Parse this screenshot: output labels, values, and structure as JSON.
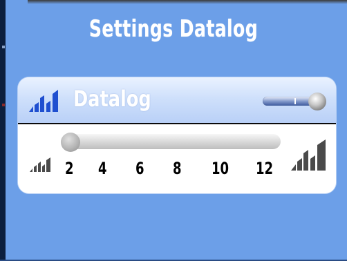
{
  "window": {
    "title": "Settings Datalog"
  },
  "card": {
    "label": "Datalog",
    "toggle_state": "on",
    "header_icon": "signal-bars-icon"
  },
  "slider": {
    "ticks": [
      "2",
      "4",
      "6",
      "8",
      "10",
      "12"
    ],
    "value": "2",
    "min_icon": "signal-low-icon",
    "max_icon": "signal-high-icon"
  },
  "colors": {
    "background": "#6c9fe8",
    "header_gradient_top": "#eaf2ff",
    "header_gradient_bottom": "#b9d0f7",
    "icon_blue": "#1f4fd0",
    "icon_gray": "#5a5a5a"
  }
}
